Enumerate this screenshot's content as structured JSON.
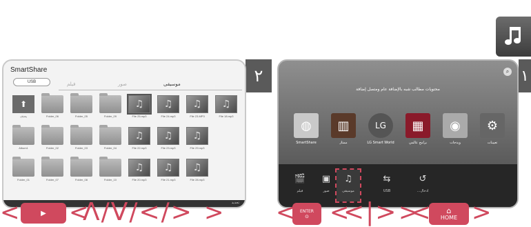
{
  "left_screen": {
    "title": "SmartShare",
    "usb_label": "USB",
    "tabs": [
      "موسيقى",
      "صور",
      "فيلم"
    ],
    "grid": [
      {
        "type": "up",
        "label": "يحذف"
      },
      {
        "type": "folder",
        "label": "Folder_06"
      },
      {
        "type": "folder",
        "label": "Folder_05"
      },
      {
        "type": "folder",
        "label": "Folder_09"
      },
      {
        "type": "music",
        "label": "File 25.mp3",
        "selected": true
      },
      {
        "type": "music",
        "label": "File 24.mp3"
      },
      {
        "type": "music",
        "label": "File 23.MP3"
      },
      {
        "type": "music",
        "label": "File 18.mp3"
      },
      {
        "type": "folder",
        "label": "Album1"
      },
      {
        "type": "folder",
        "label": "Folder_02"
      },
      {
        "type": "folder",
        "label": "Folder_03"
      },
      {
        "type": "folder",
        "label": "Folder_04"
      },
      {
        "type": "music",
        "label": "File 22.mp3"
      },
      {
        "type": "music",
        "label": "File 23.mp3"
      },
      {
        "type": "music",
        "label": "File 29.mp3"
      },
      {
        "type": "folder",
        "label": "Folder_01"
      },
      {
        "type": "folder",
        "label": "Folder_07"
      },
      {
        "type": "folder",
        "label": "Folder_08"
      },
      {
        "type": "folder",
        "label": "Folder_10"
      },
      {
        "type": "music",
        "label": "File 20.mp3"
      },
      {
        "type": "music",
        "label": "File 21.mp3"
      },
      {
        "type": "music",
        "label": "File 28.mp3"
      }
    ],
    "footer": "تحديد"
  },
  "right_screen": {
    "message": "محتويات مطالب شبه بالإضافة عام ومتصل إضافة",
    "apps": [
      {
        "label": "SmartShare",
        "icon": "◍",
        "color": "#c9c9c9"
      },
      {
        "label": "ممتاز",
        "icon": "▥",
        "color": "#5a3a2a"
      },
      {
        "label": "LG Smart World",
        "icon": "LG",
        "color": "#555555"
      },
      {
        "label": "برامج عالمي",
        "icon": "▦",
        "color": "#8a1a2a"
      },
      {
        "label": "ويدجات",
        "icon": "◉",
        "color": "#aaaaaa"
      },
      {
        "label": "تعيينات",
        "icon": "⚙",
        "color": "#666666"
      }
    ],
    "nav": [
      {
        "label": "فيلم",
        "icon": "🎬"
      },
      {
        "label": "صور",
        "icon": "▣"
      },
      {
        "label": "موسيقى",
        "icon": "♫",
        "selected": true
      },
      {
        "label": "USB",
        "icon": "⇆"
      },
      {
        "label": "...ادخال",
        "icon": "↺"
      }
    ]
  },
  "steps": {
    "two": "٢",
    "one": "١"
  },
  "buttons": {
    "play": "▶",
    "arrows": "Λ/V/</>",
    "enter": "ENTER",
    "lr": "<|>",
    "home": "HOME"
  },
  "colors": {
    "accent": "#d0495e"
  }
}
